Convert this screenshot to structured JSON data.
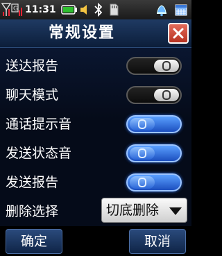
{
  "status_bar": {
    "time": "11:31",
    "icons": [
      "signal-icon",
      "gprs-icon",
      "battery-icon",
      "volume-icon",
      "bluetooth-icon",
      "memory-card-icon",
      "bell-icon",
      "calendar-icon"
    ]
  },
  "header": {
    "title": "常规设置",
    "close_icon": "close-icon",
    "accent": "#c23b2a"
  },
  "settings": [
    {
      "label": "送达报告",
      "state": "off"
    },
    {
      "label": "聊天模式",
      "state": "off"
    },
    {
      "label": "通话提示音",
      "state": "on"
    },
    {
      "label": "发送状态音",
      "state": "on"
    },
    {
      "label": "发送报告",
      "state": "on"
    }
  ],
  "delete_option": {
    "label": "删除选择",
    "value": "切底删除"
  },
  "softkeys": {
    "left": "确定",
    "right": "取消"
  },
  "colors": {
    "toggle_on": "#3d7ff0",
    "toggle_off": "#1a1a1a",
    "title_bar": "#1a3560"
  }
}
